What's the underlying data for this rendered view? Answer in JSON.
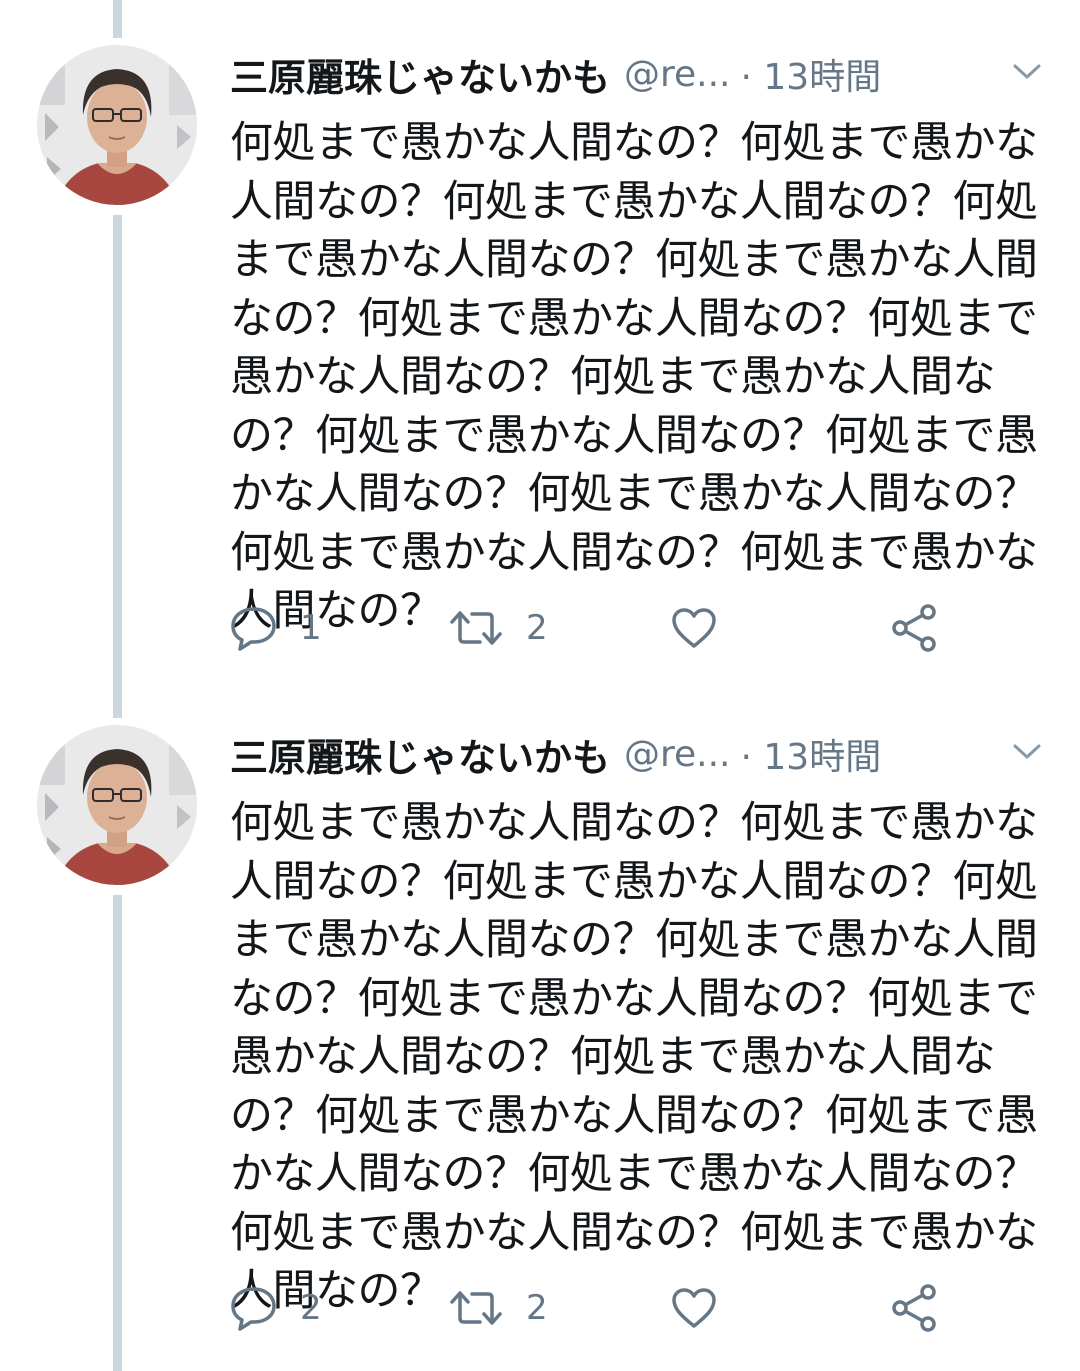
{
  "tweets": [
    {
      "display_name": "三原麗珠じゃないかも",
      "handle": "@re...",
      "time": "· 13時間",
      "text": "何処まで愚かな人間なの？何処まで愚かな人間なの？何処まで愚かな人間なの？何処まで愚かな人間なの？何処まで愚かな人間なの？何処まで愚かな人間なの？何処まで愚かな人間なの？何処まで愚かな人間なの？何処まで愚かな人間なの？何処まで愚かな人間なの？何処まで愚かな人間なの？何処まで愚かな人間なの？何処まで愚かな人間なの？",
      "reply_count": "1",
      "retweet_count": "2",
      "like_count": ""
    },
    {
      "display_name": "三原麗珠じゃないかも",
      "handle": "@re...",
      "time": "· 13時間",
      "text": "何処まで愚かな人間なの？何処まで愚かな人間なの？何処まで愚かな人間なの？何処まで愚かな人間なの？何処まで愚かな人間なの？何処まで愚かな人間なの？何処まで愚かな人間なの？何処まで愚かな人間なの？何処まで愚かな人間なの？何処まで愚かな人間なの？何処まで愚かな人間なの？何処まで愚かな人間なの？何処まで愚かな人間なの？",
      "reply_count": "2",
      "retweet_count": "2",
      "like_count": ""
    }
  ],
  "colors": {
    "text": "#14171a",
    "secondary": "#657786",
    "thread_line": "#ccd6dd",
    "shirt": "#a8473f"
  },
  "icons": {
    "reply": "reply-icon",
    "retweet": "retweet-icon",
    "like": "heart-icon",
    "share": "share-icon",
    "more": "chevron-down-icon"
  }
}
